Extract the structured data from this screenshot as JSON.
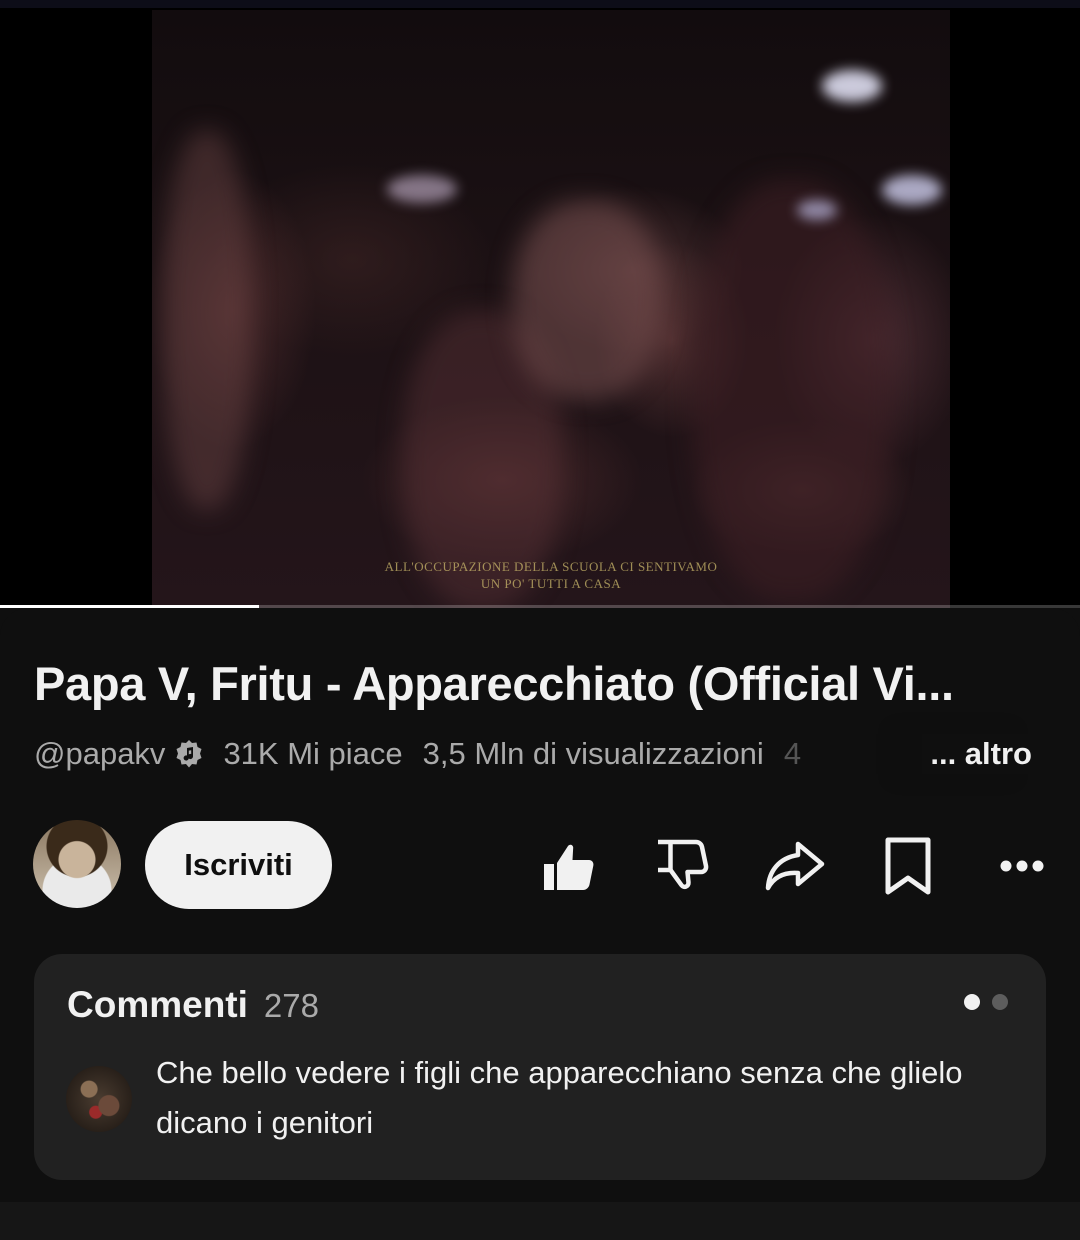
{
  "video": {
    "subtitle_line1": "ALL'OCCUPAZIONE DELLA SCUOLA CI SENTIVAMO",
    "subtitle_line2": "UN PO' TUTTI A CASA",
    "progress_fraction": 0.24
  },
  "info": {
    "title": "Papa V, Fritu - Apparecchiato (Official Vi...",
    "channel_handle": "@papakv",
    "likes": "31K Mi piace",
    "views": "3,5 Mln di visualizzazioni",
    "age_fragment": "4",
    "more_label": "... altro"
  },
  "actions": {
    "subscribe_label": "Iscriviti"
  },
  "comments": {
    "title": "Commenti",
    "count": "278",
    "first_comment": "Che bello vedere i figli che apparecchiano senza che glielo dicano i genitori"
  },
  "icons": {
    "verified": "music-note-verified-icon",
    "like": "thumbs-up-filled-icon",
    "dislike": "thumbs-down-icon",
    "share": "share-arrow-icon",
    "save": "bookmark-icon",
    "more": "more-horizontal-icon"
  },
  "colors": {
    "background": "#0f0f0f",
    "card": "#212121",
    "text_primary": "#f1f1f1",
    "text_secondary": "#aaaaaa",
    "subscribe_bg": "#f1f1f1"
  }
}
